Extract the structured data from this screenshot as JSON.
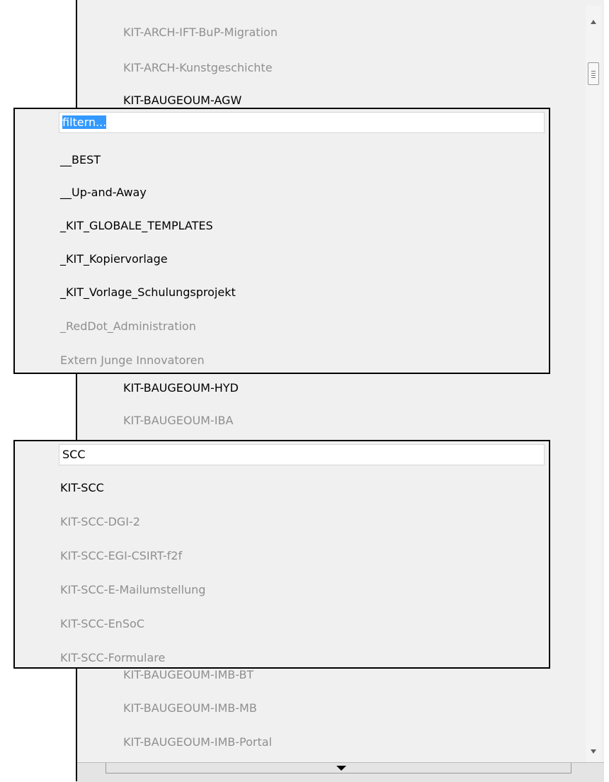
{
  "background_list": {
    "items": [
      {
        "label": "KIT-ARCH-IFT-BuP-Migration",
        "enabled": false
      },
      {
        "label": "KIT-ARCH-Kunstgeschichte",
        "enabled": false
      },
      {
        "label": "KIT-BAUGEOUM-AGW",
        "enabled": true
      },
      {
        "label": "KIT-BAUGEOUM-HYD",
        "enabled": true
      },
      {
        "label": "KIT-BAUGEOUM-IBA",
        "enabled": false
      },
      {
        "label": "KIT-BAUGEOUM-IMB-BT",
        "enabled": false
      },
      {
        "label": "KIT-BAUGEOUM-IMB-MB",
        "enabled": false
      },
      {
        "label": "KIT-BAUGEOUM-IMB-Portal",
        "enabled": false
      }
    ]
  },
  "dropdown_a": {
    "filter_value": "filtern...",
    "items": [
      {
        "label": "__BEST",
        "enabled": true
      },
      {
        "label": "__Up-and-Away",
        "enabled": true
      },
      {
        "label": "_KIT_GLOBALE_TEMPLATES",
        "enabled": true
      },
      {
        "label": "_KIT_Kopiervorlage",
        "enabled": true
      },
      {
        "label": "_KIT_Vorlage_Schulungsprojekt",
        "enabled": true
      },
      {
        "label": "_RedDot_Administration",
        "enabled": false
      },
      {
        "label": "Extern Junge Innovatoren",
        "enabled": false
      }
    ]
  },
  "dropdown_b": {
    "filter_value": "SCC",
    "items": [
      {
        "label": "KIT-SCC",
        "enabled": true
      },
      {
        "label": "KIT-SCC-DGI-2",
        "enabled": false
      },
      {
        "label": "KIT-SCC-EGI-CSIRT-f2f",
        "enabled": false
      },
      {
        "label": "KIT-SCC-E-Mailumstellung",
        "enabled": false
      },
      {
        "label": "KIT-SCC-EnSoC",
        "enabled": false
      },
      {
        "label": "KIT-SCC-Formulare",
        "enabled": false
      }
    ]
  },
  "icons": {
    "scroll_up": "arrow-up-icon",
    "scroll_down": "arrow-down-icon",
    "scroll_thumb": "scrollbar-thumb",
    "expand": "triangle-down-icon"
  }
}
